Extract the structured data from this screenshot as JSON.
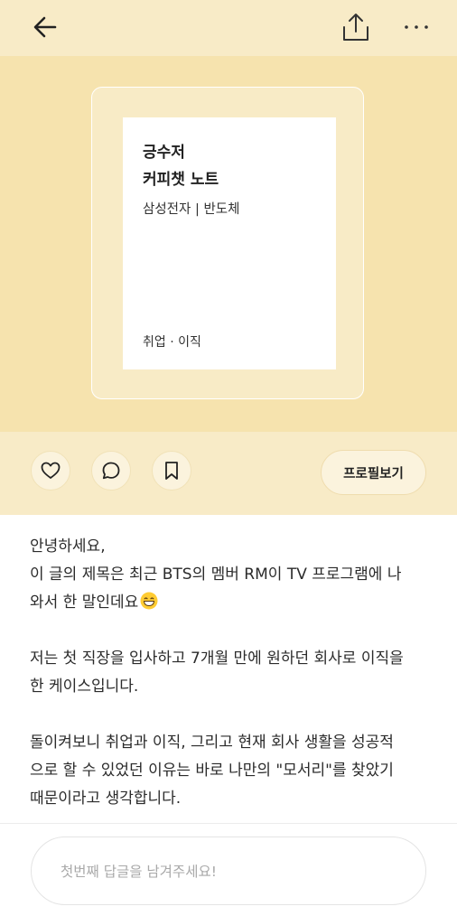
{
  "header": {
    "back_icon": "arrow-left-icon",
    "share_icon": "share-upload-icon",
    "more_icon": "more-horizontal-icon"
  },
  "card": {
    "title_line1": "긍수저",
    "title_line2": "커피챗 노트",
    "subtitle": "삼성전자 | 반도체",
    "category": "취업 · 이직"
  },
  "actions": {
    "like_icon": "heart-icon",
    "comment_icon": "comment-icon",
    "bookmark_icon": "bookmark-icon",
    "profile_label": "프로필보기"
  },
  "article": {
    "p1_line1": "안녕하세요,",
    "p1_line2": "이 글의 제목은 최근 BTS의 멤버 RM이 TV 프로그램에 나",
    "p1_line3": "와서 한 말인데요",
    "emoji": "grinning-face-emoji",
    "p2_line1": "저는 첫 직장을 입사하고 7개월 만에 원하던 회사로 이직을",
    "p2_line2": "한 케이스입니다.",
    "p3_line1": "돌이켜보니 취업과 이직, 그리고 현재 회사 생활을 성공적",
    "p3_line2": "으로 할 수 있었던 이유는 바로 나만의 \"모서리\"를 찾았기",
    "p3_line3": "때문이라고 생각합니다."
  },
  "reply": {
    "placeholder": "첫번째 답글을 남겨주세요!",
    "value": ""
  },
  "colors": {
    "header_bg": "#f8ebc7",
    "hero_bg": "#f6e3ae",
    "frame_bg": "#f8ebc6",
    "button_bg": "#fbf3dd"
  }
}
